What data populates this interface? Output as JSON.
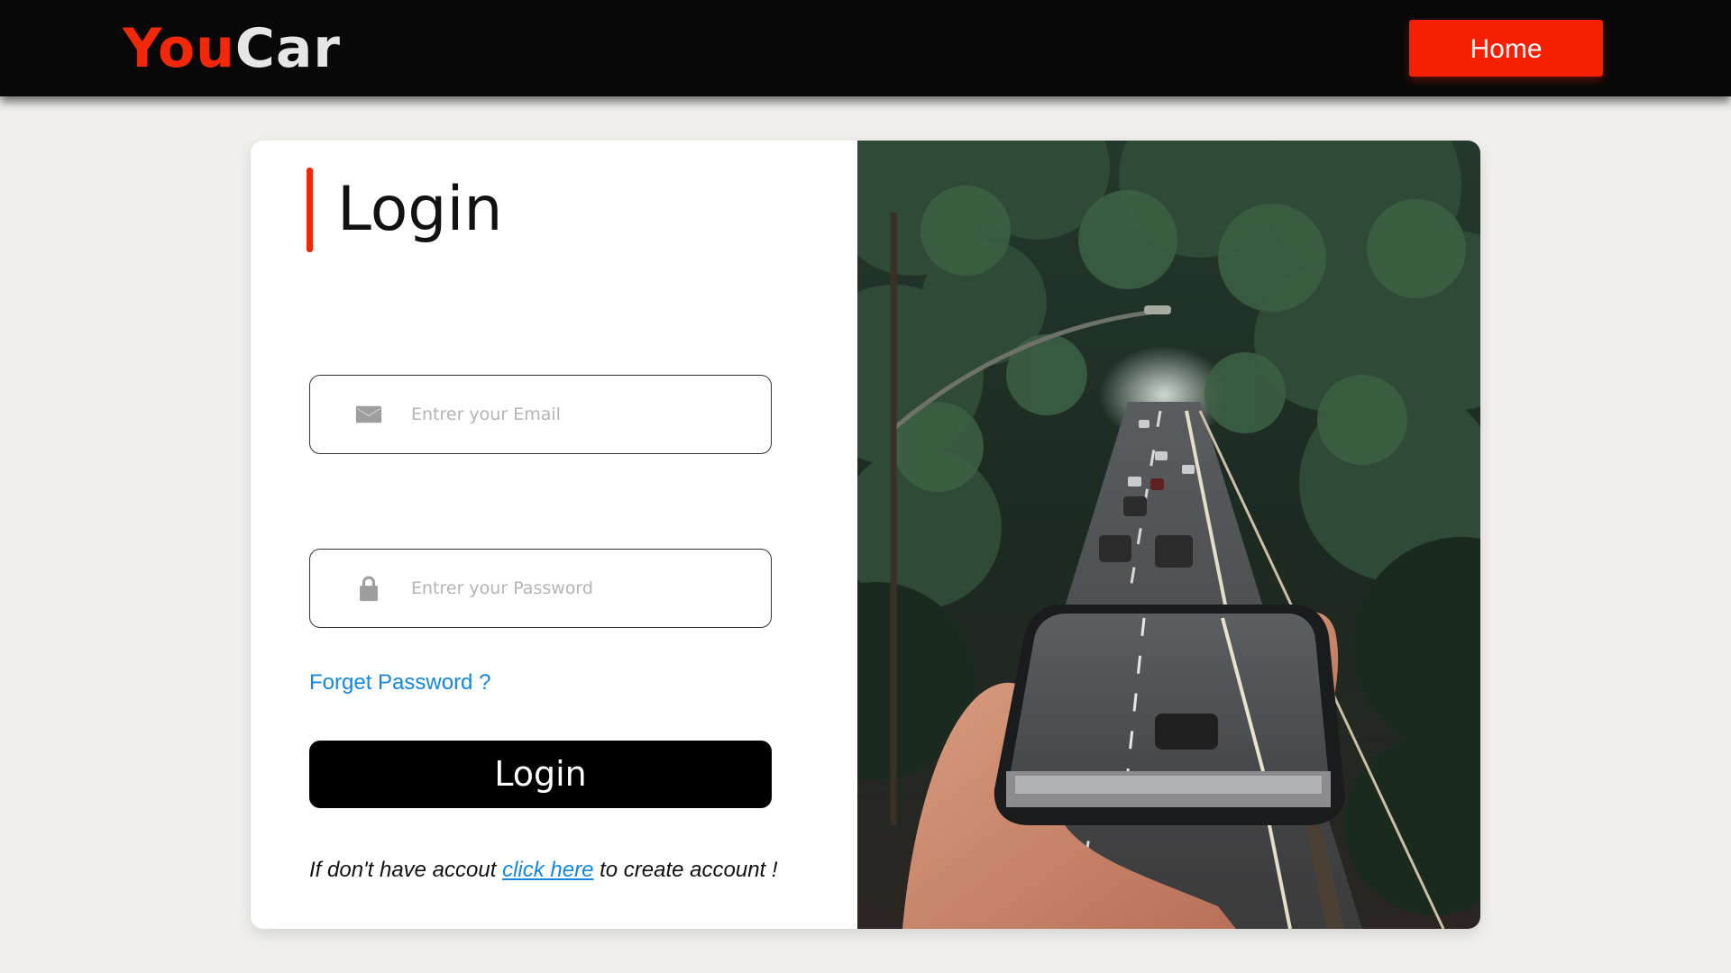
{
  "header": {
    "brand_part1": "You",
    "brand_part2": "Car",
    "home_label": "Home",
    "brand_color": "#f32709",
    "accent_color": "#f51f02"
  },
  "login": {
    "title": "Login",
    "email": {
      "placeholder": "Entrer your Email",
      "value": "",
      "icon": "mail-icon"
    },
    "password": {
      "placeholder": "Entrer your Password",
      "value": "",
      "icon": "lock-icon"
    },
    "forget_password": "Forget Password ?",
    "submit_label": "Login",
    "signup_prefix": "If don't have accout",
    "signup_link": "click here",
    "signup_suffix": "to create account !"
  },
  "photo": {
    "subject": "hand holding phone showing tree-lined road with cars"
  }
}
